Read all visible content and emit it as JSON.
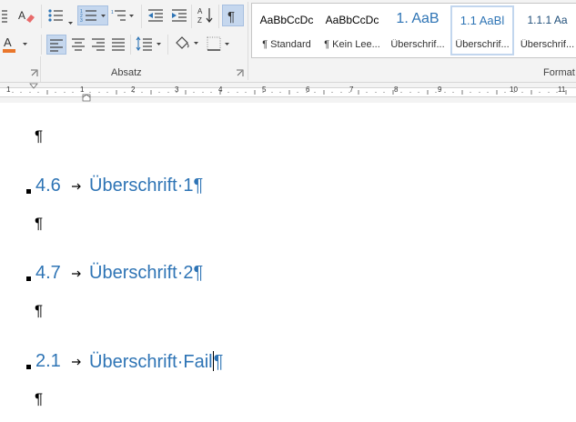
{
  "ribbon": {
    "group_label": "Absatz",
    "format_label": "Formatvorlagen",
    "format_label_visible": "Format",
    "icons": [
      "line-spacing-icon",
      "clear-formatting-icon",
      "bullets-icon",
      "numbering-icon",
      "multilevel-list-icon",
      "decrease-indent-icon",
      "increase-indent-icon",
      "sort-icon",
      "show-paragraph-marks-icon",
      "font-color-icon",
      "align-left-icon",
      "align-center-icon",
      "align-right-icon",
      "justify-icon",
      "paragraph-spacing-icon",
      "shading-icon",
      "borders-icon"
    ],
    "styles": [
      {
        "preview": "AaBbCcDc",
        "name": "¶ Standard",
        "selected": false
      },
      {
        "preview": "AaBbCcDc",
        "name": "¶ Kein Lee...",
        "selected": false
      },
      {
        "preview": "1.  AaB",
        "name": "Überschrif...",
        "selected": false
      },
      {
        "preview": "1.1  AaBl",
        "name": "Überschrif...",
        "selected": true
      },
      {
        "preview": "1.1.1  Aa",
        "name": "Überschrif...",
        "selected": false
      }
    ]
  },
  "ruler": {
    "numbers": [
      "1",
      "1",
      "2",
      "3",
      "4",
      "5",
      "6",
      "7",
      "8",
      "9",
      "10",
      "11"
    ]
  },
  "document": {
    "pilcrow": "¶",
    "headings": [
      {
        "number": "4.6",
        "text": "Überschrift·1¶"
      },
      {
        "number": "4.7",
        "text": "Überschrift·2¶"
      },
      {
        "number": "2.1",
        "text_before_cursor": "Überschrift·Fail",
        "text_after_cursor": "¶"
      }
    ]
  },
  "colors": {
    "heading": "#2e74b5",
    "ribbon_bg": "#f3f3f3",
    "pressed": "#c5d7ee",
    "font_color_bar": "#e9762b"
  }
}
